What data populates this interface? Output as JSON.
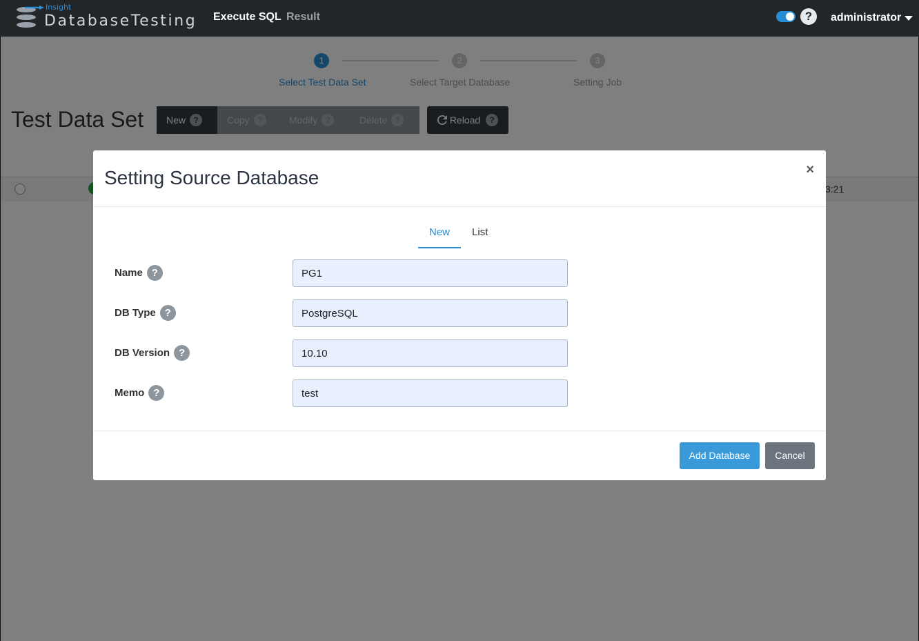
{
  "app": {
    "logo_top": "Insight",
    "logo_name": "DatabaseTesting",
    "nav": [
      "Execute SQL",
      "Result"
    ],
    "user": "administrator",
    "help_glyph": "?"
  },
  "stepper": [
    {
      "number": "1",
      "label": "Select Test Data Set",
      "active": true
    },
    {
      "number": "2",
      "label": "Select Target Database",
      "active": false
    },
    {
      "number": "3",
      "label": "Setting Job",
      "active": false
    }
  ],
  "page": {
    "title": "Test Data Set",
    "toolbar": {
      "new": "New",
      "copy": "Copy",
      "modify": "Modify",
      "delete": "Delete",
      "reload": "Reload"
    },
    "row_time_fragment": "3:21"
  },
  "modal": {
    "title": "Setting Source Database",
    "close": "×",
    "tabs": [
      "New",
      "List"
    ],
    "active_tab": "New",
    "fields": [
      {
        "label": "Name",
        "value": "PG1"
      },
      {
        "label": "DB Type",
        "value": "PostgreSQL"
      },
      {
        "label": "DB Version",
        "value": "10.10"
      },
      {
        "label": "Memo",
        "value": "test"
      }
    ],
    "buttons": {
      "submit": "Add Database",
      "cancel": "Cancel"
    }
  },
  "colors": {
    "accent": "#2a8ed4",
    "navbar": "#222629",
    "primary_button": "#3a9ad9",
    "secondary_button": "#6c757d",
    "status_ok": "#28a745"
  }
}
